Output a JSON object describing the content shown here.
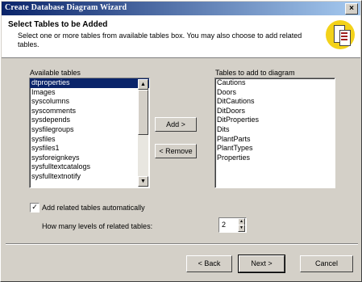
{
  "window": {
    "title": "Create Database Diagram Wizard",
    "close_glyph": "×"
  },
  "header": {
    "title": "Select Tables to be Added",
    "description": "Select one or more tables from available tables box. You may also choose to add related tables.",
    "icon": "database-diagram-icon"
  },
  "available": {
    "label": "Available tables",
    "items": [
      "dtproperties",
      "Images",
      "syscolumns",
      "syscomments",
      "sysdepends",
      "sysfilegroups",
      "sysfiles",
      "sysfiles1",
      "sysforeignkeys",
      "sysfulltextcatalogs",
      "sysfulltextnotify"
    ],
    "selected_index": 0
  },
  "added": {
    "label": "Tables to add to diagram",
    "items": [
      "Cautions",
      "Doors",
      "DitCautions",
      "DitDoors",
      "DitProperties",
      "Dits",
      "PlantParts",
      "PlantTypes",
      "Properties"
    ]
  },
  "buttons": {
    "add": "Add >",
    "remove": "< Remove",
    "back": "< Back",
    "next": "Next >",
    "cancel": "Cancel"
  },
  "options": {
    "add_related_label": "Add related tables automatically",
    "add_related_checked": "✓",
    "levels_label": "How many levels of related tables:",
    "levels_value": "2"
  }
}
